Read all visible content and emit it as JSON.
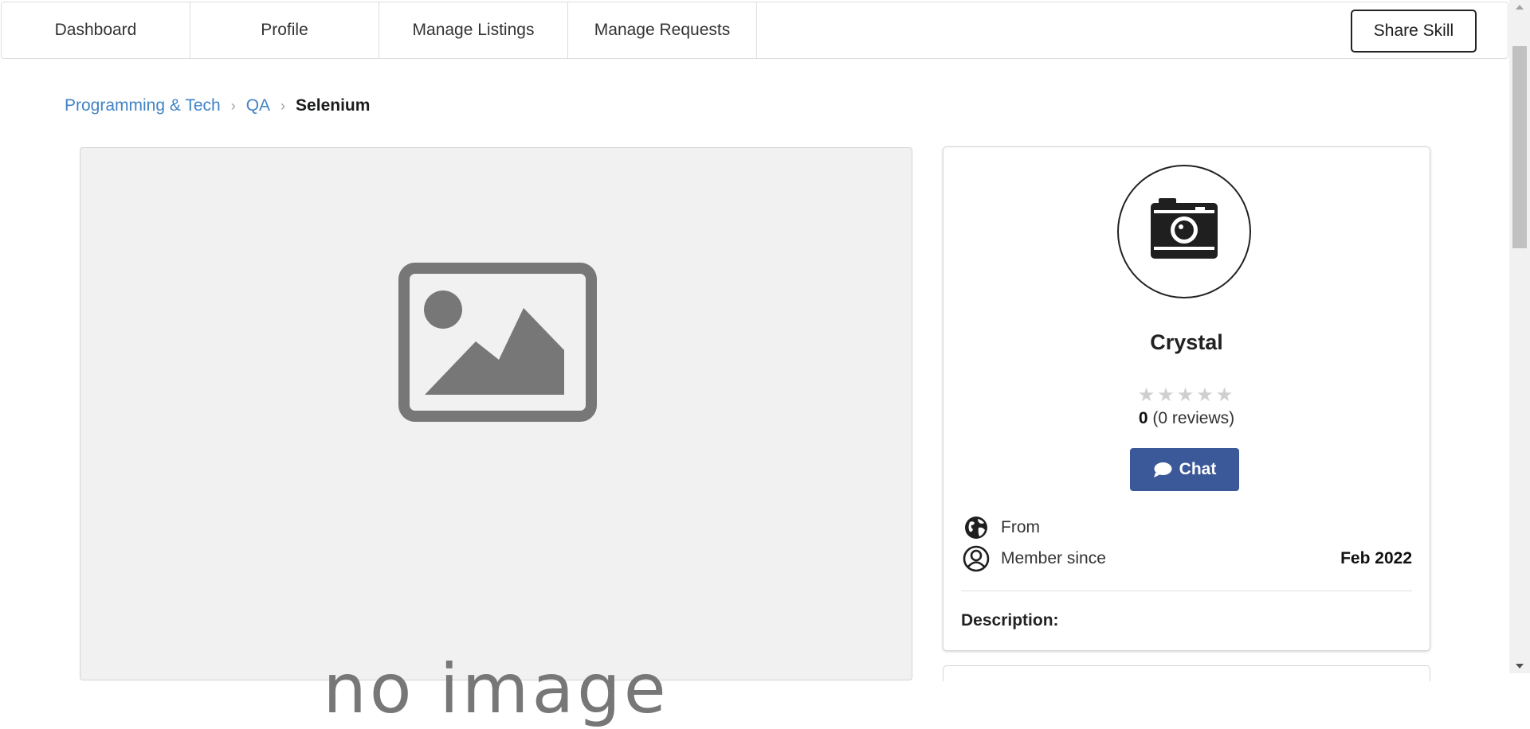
{
  "nav": {
    "items": [
      {
        "label": "Dashboard"
      },
      {
        "label": "Profile"
      },
      {
        "label": "Manage Listings"
      },
      {
        "label": "Manage Requests"
      }
    ],
    "share_label": "Share Skill"
  },
  "breadcrumb": {
    "items": [
      "Programming & Tech",
      "QA"
    ],
    "divider": "›",
    "active": "Selenium"
  },
  "image": {
    "placeholder_text": "no image",
    "icon": "image-placeholder-icon"
  },
  "profile": {
    "avatar_icon": "camera-icon",
    "name": "Crystal",
    "stars": "★★★★★",
    "rating_max": 5,
    "rating": 0,
    "rating_value": "0",
    "review_count_text": "(0 reviews)",
    "chat_label": "Chat",
    "from_label": "From",
    "member_since_label": "Member since",
    "member_since_value": "Feb 2022",
    "description_label": "Description:"
  },
  "colors": {
    "link": "#4183c4",
    "chat_button": "#3b5998",
    "star_empty": "#cfcfcf",
    "image_bg": "#f1f1f1"
  }
}
